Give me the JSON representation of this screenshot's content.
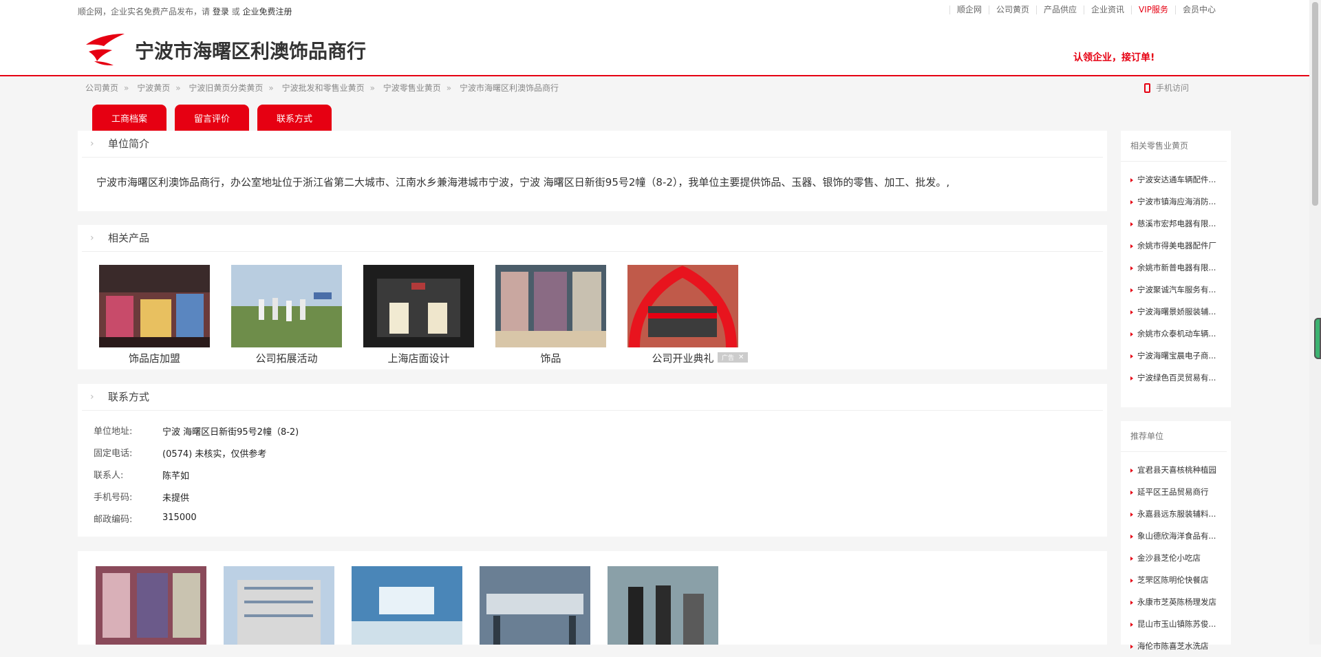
{
  "topbar": {
    "notice_prefix": "顺企网，企业实名免费产品发布，请",
    "login": "登录",
    "or": "或",
    "register": "企业免费注册",
    "nav": [
      "顺企网",
      "公司黄页",
      "产品供应",
      "企业资讯",
      "VIP服务",
      "会员中心"
    ]
  },
  "header": {
    "company_name": "宁波市海曙区利澳饰品商行",
    "slogan": "认领企业，接订单!"
  },
  "breadcrumb": [
    "公司黄页",
    "宁波黄页",
    "宁波旧黄页分类黄页",
    "宁波批发和零售业黄页",
    "宁波零售业黄页",
    "宁波市海曙区利澳饰品商行"
  ],
  "breadcrumb_sep": "»",
  "mobile_access": "手机访问",
  "tabs": [
    "工商档案",
    "留言评价",
    "联系方式"
  ],
  "intro": {
    "heading": "单位简介",
    "text": "宁波市海曙区利澳饰品商行，办公室地址位于浙江省第二大城市、江南水乡兼海港城市宁波，宁波 海曙区日新街95号2幢（8-2），我单位主要提供饰品、玉器、银饰的零售、加工、批发。,"
  },
  "products": {
    "heading": "相关产品",
    "items": [
      "饰品店加盟",
      "公司拓展活动",
      "上海店面设计",
      "饰品",
      "公司开业典礼"
    ],
    "ad_label": "广告"
  },
  "contact": {
    "heading": "联系方式",
    "rows": [
      {
        "label": "单位地址:",
        "value": "宁波 海曙区日新街95号2幢（8-2)"
      },
      {
        "label": "固定电话:",
        "value": "(0574) 未核实，仅供参考"
      },
      {
        "label": "联系人:",
        "value": "陈芊如"
      },
      {
        "label": "手机号码:",
        "value": "未提供"
      },
      {
        "label": "邮政编码:",
        "value": "315000"
      }
    ]
  },
  "sidebar": {
    "related_title": "相关零售业黄页",
    "related": [
      "宁波安达通车辆配件...",
      "宁波市镇海应海消防...",
      "慈溪市宏邦电器有限...",
      "余姚市得美电器配件厂",
      "余姚市新普电器有限...",
      "宁波聚诚汽车服务有...",
      "宁波海曙景娇服装辅...",
      "余姚市众泰机动车辆...",
      "宁波海曙宝晨电子商...",
      "宁波绿色百灵贸易有..."
    ],
    "recommend_title": "推荐单位",
    "recommend": [
      "宜君县天喜核桃种植园",
      "延平区王品贸易商行",
      "永嘉县远东服装辅料...",
      "象山德欣海洋食品有...",
      "金沙县芝伦小吃店",
      "芝罘区陈明伦快餐店",
      "永康市芝英陈杨理发店",
      "昆山市玉山镇陈苏俊...",
      "海伦市陈喜芝水洗店"
    ]
  }
}
